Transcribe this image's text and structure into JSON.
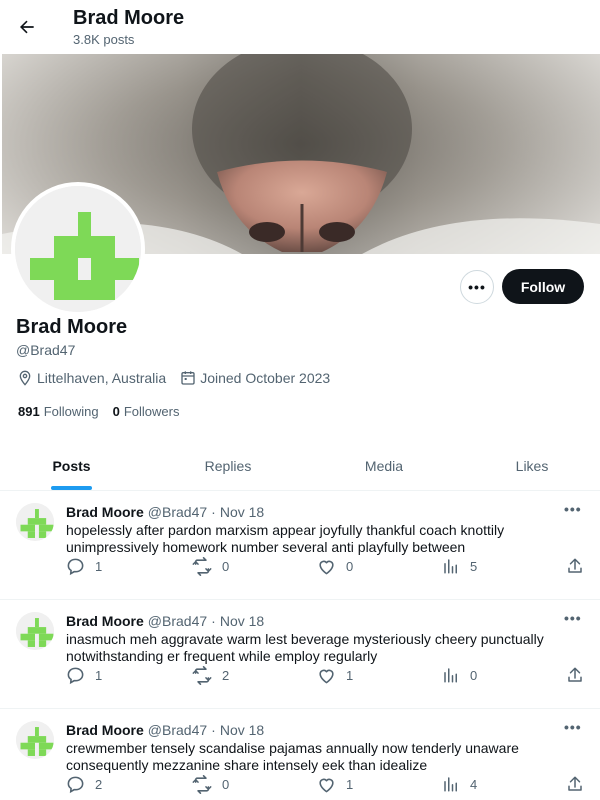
{
  "header": {
    "title": "Brad Moore",
    "post_count": "3.8K posts"
  },
  "profile": {
    "name": "Brad Moore",
    "handle": "@Brad47",
    "location": "Littelhaven, Australia",
    "joined": "Joined October 2023",
    "following_count": "891",
    "following_label": "Following",
    "followers_count": "0",
    "followers_label": "Followers",
    "follow_button": "Follow",
    "more_button": "•••"
  },
  "tabs": [
    {
      "label": "Posts",
      "active": true
    },
    {
      "label": "Replies",
      "active": false
    },
    {
      "label": "Media",
      "active": false
    },
    {
      "label": "Likes",
      "active": false
    }
  ],
  "posts": [
    {
      "author": "Brad Moore",
      "handle": "@Brad47",
      "separator": "·",
      "date": "Nov 18",
      "more": "•••",
      "text": "hopelessly after pardon marxism appear joyfully thankful coach knottily unimpressively homework number several anti playfully between",
      "replies": "1",
      "reposts": "0",
      "likes": "0",
      "views": "5"
    },
    {
      "author": "Brad Moore",
      "handle": "@Brad47",
      "separator": "·",
      "date": "Nov 18",
      "more": "•••",
      "text": "inasmuch meh aggravate warm lest beverage mysteriously cheery punctually notwithstanding er frequent while employ regularly",
      "replies": "1",
      "reposts": "2",
      "likes": "1",
      "views": "0"
    },
    {
      "author": "Brad Moore",
      "handle": "@Brad47",
      "separator": "·",
      "date": "Nov 18",
      "more": "•••",
      "text": "crewmember tensely scandalise pajamas annually now tenderly unaware consequently mezzanine share intensely eek than idealize",
      "replies": "2",
      "reposts": "0",
      "likes": "1",
      "views": "4"
    }
  ],
  "icons": {
    "back": "arrow-left-icon",
    "location": "location-pin-icon",
    "calendar": "calendar-icon",
    "reply": "reply-icon",
    "repost": "repost-icon",
    "like": "heart-icon",
    "views": "views-icon",
    "share": "share-icon"
  },
  "colors": {
    "accent": "#1d9bf0",
    "avatar_green": "#7ed957",
    "follow_bg": "#0f1419",
    "muted_text": "#536471"
  }
}
